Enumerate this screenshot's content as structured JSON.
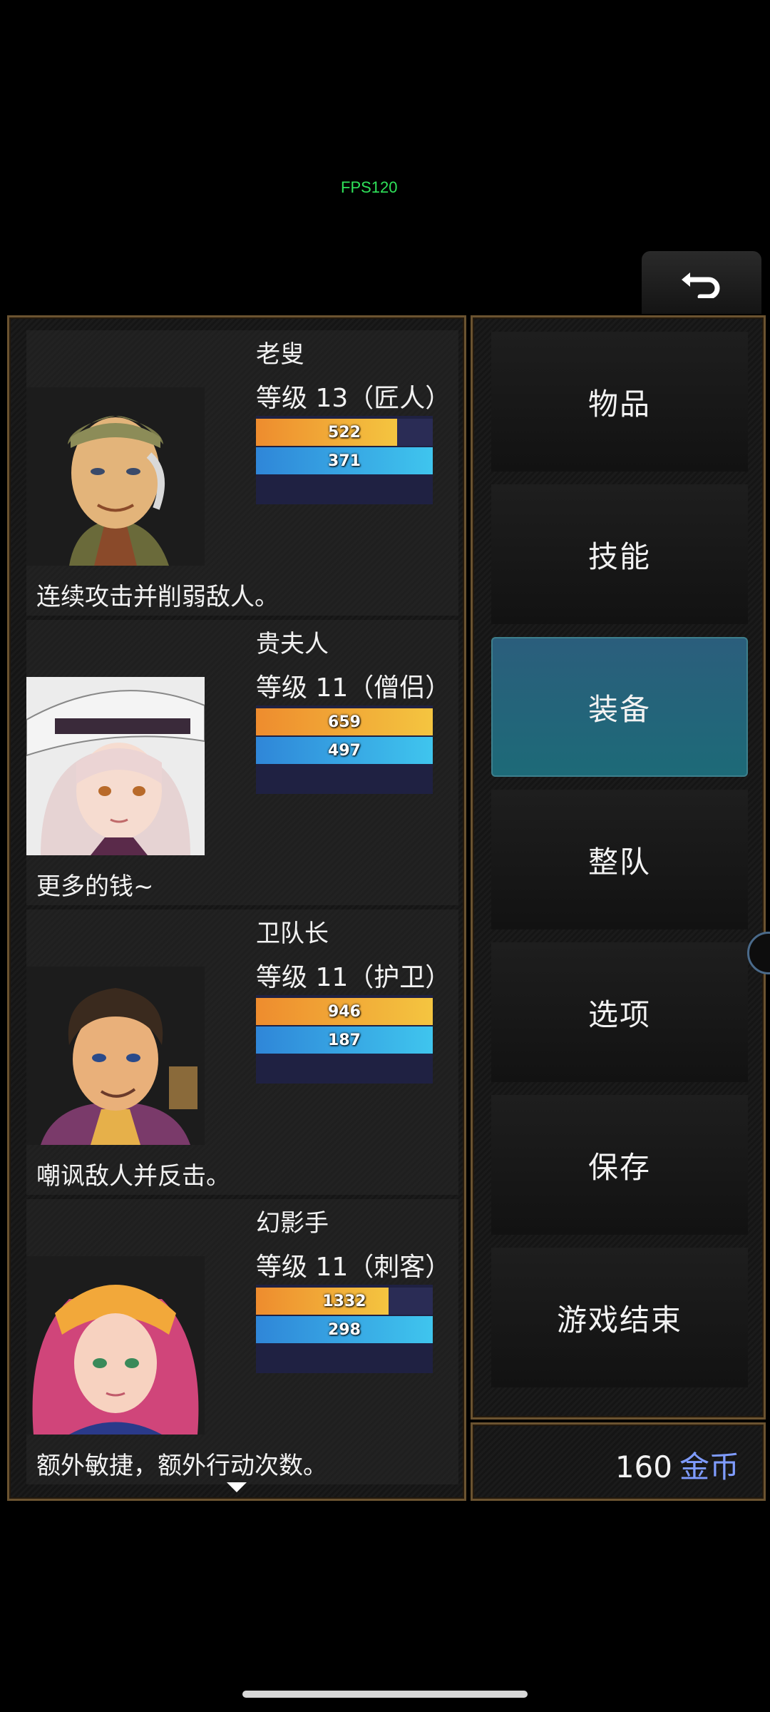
{
  "overlay": {
    "fps": "FPS120"
  },
  "header": {
    "back_icon": "return-arrow-icon"
  },
  "party": [
    {
      "name": "老叟",
      "level": "等级 13（匠人）",
      "hp": 522,
      "hp_ratio": 0.8,
      "mp": 371,
      "mp_ratio": 1.0,
      "skill": "连续攻击并削弱敌人。"
    },
    {
      "name": "贵夫人",
      "level": "等级 11（僧侣）",
      "hp": 659,
      "hp_ratio": 1.0,
      "mp": 497,
      "mp_ratio": 1.0,
      "skill": "更多的钱~"
    },
    {
      "name": "卫队长",
      "level": "等级 11（护卫）",
      "hp": 946,
      "hp_ratio": 1.0,
      "mp": 187,
      "mp_ratio": 1.0,
      "skill": "嘲讽敌人并反击。"
    },
    {
      "name": "幻影手",
      "level": "等级 11（刺客）",
      "hp": 1332,
      "hp_ratio": 0.75,
      "mp": 298,
      "mp_ratio": 1.0,
      "skill": "额外敏捷，额外行动次数。"
    }
  ],
  "menu": {
    "items": [
      "物品",
      "技能",
      "装备",
      "整队",
      "选项",
      "保存",
      "游戏结束"
    ],
    "selected_index": 2
  },
  "gold": {
    "amount": "160",
    "unit": "金币",
    "unit_color": "#7f9cff"
  },
  "colors": {
    "frame": "#6b5330",
    "selected": "#1d6a78",
    "hp": "#f4c540",
    "mp": "#3fc5ee"
  }
}
